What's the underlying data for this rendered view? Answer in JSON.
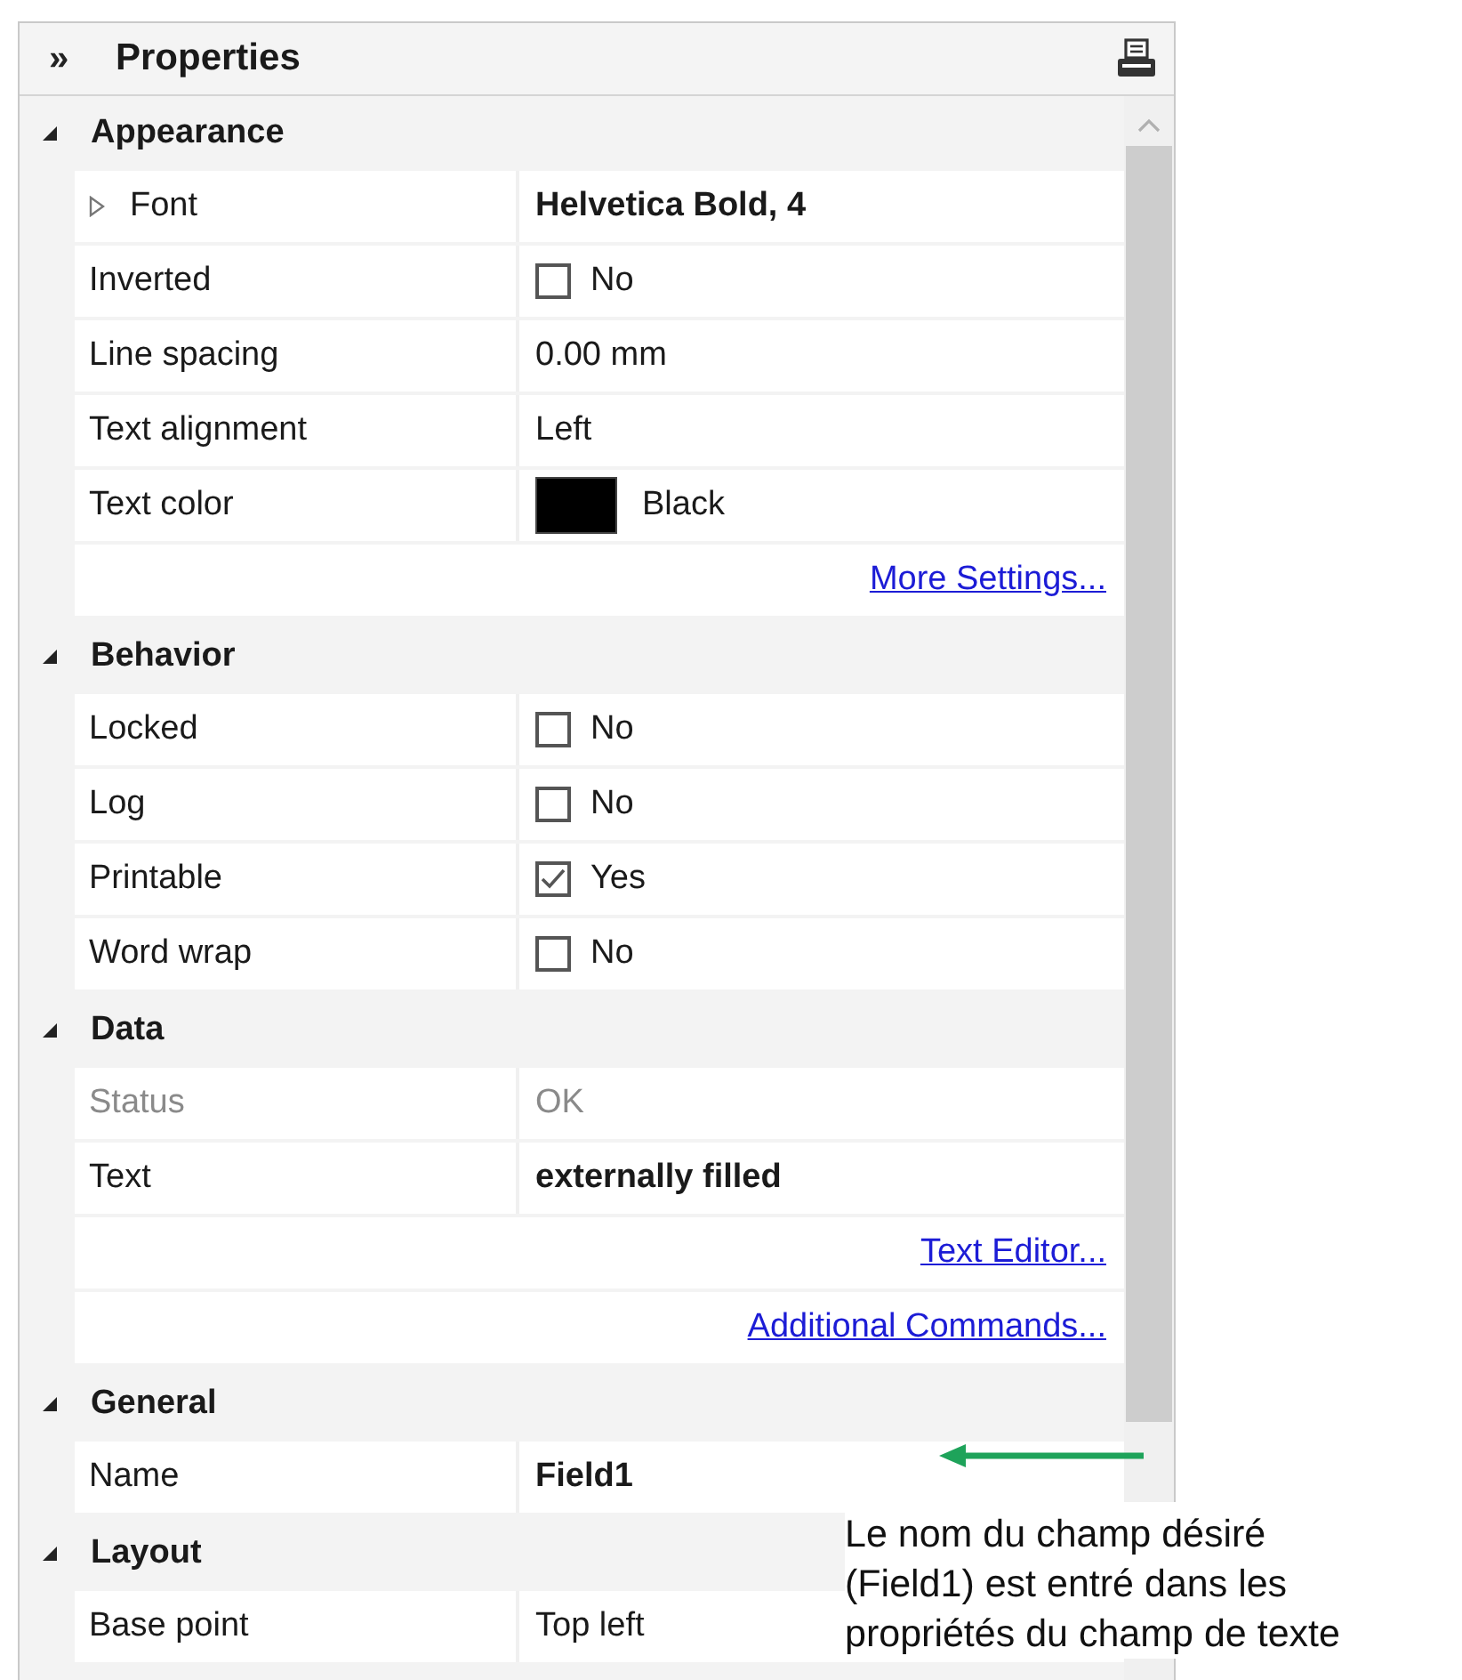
{
  "panel": {
    "collapse_glyph": "»",
    "title": "Properties"
  },
  "sections": [
    {
      "title": "Appearance",
      "expanded": true,
      "rows": [
        {
          "kind": "property",
          "label": "Font",
          "expandable": true,
          "value": "Helvetica Bold, 4",
          "bold": true,
          "disabled": false
        },
        {
          "kind": "checkbox",
          "label": "Inverted",
          "checked": false,
          "value": "No"
        },
        {
          "kind": "property",
          "label": "Line spacing",
          "expandable": false,
          "value": "0.00 mm",
          "bold": false,
          "disabled": false
        },
        {
          "kind": "property",
          "label": "Text alignment",
          "expandable": false,
          "value": "Left",
          "bold": false,
          "disabled": false
        },
        {
          "kind": "color",
          "label": "Text color",
          "color": "#000000",
          "value": "Black"
        },
        {
          "kind": "link",
          "value": "More Settings..."
        }
      ]
    },
    {
      "title": "Behavior",
      "expanded": true,
      "rows": [
        {
          "kind": "checkbox",
          "label": "Locked",
          "checked": false,
          "value": "No"
        },
        {
          "kind": "checkbox",
          "label": "Log",
          "checked": false,
          "value": "No"
        },
        {
          "kind": "checkbox",
          "label": "Printable",
          "checked": true,
          "value": "Yes"
        },
        {
          "kind": "checkbox",
          "label": "Word wrap",
          "checked": false,
          "value": "No"
        }
      ]
    },
    {
      "title": "Data",
      "expanded": true,
      "rows": [
        {
          "kind": "property",
          "label": "Status",
          "expandable": false,
          "value": "OK",
          "bold": false,
          "disabled": true
        },
        {
          "kind": "property",
          "label": "Text",
          "expandable": false,
          "value": "externally filled",
          "bold": true,
          "disabled": false
        },
        {
          "kind": "link",
          "value": "Text Editor..."
        },
        {
          "kind": "link",
          "value": "Additional Commands..."
        }
      ]
    },
    {
      "title": "General",
      "expanded": true,
      "rows": [
        {
          "kind": "property",
          "label": "Name",
          "expandable": false,
          "value": "Field1",
          "bold": true,
          "disabled": false
        }
      ]
    },
    {
      "title": "Layout",
      "expanded": true,
      "rows": [
        {
          "kind": "property",
          "label": "Base point",
          "expandable": false,
          "value": "Top left",
          "bold": false,
          "disabled": false
        }
      ]
    }
  ],
  "annotation": {
    "text": "Le nom du champ désiré\n(Field1) est entré dans les\npropriétés du champ de texte"
  }
}
